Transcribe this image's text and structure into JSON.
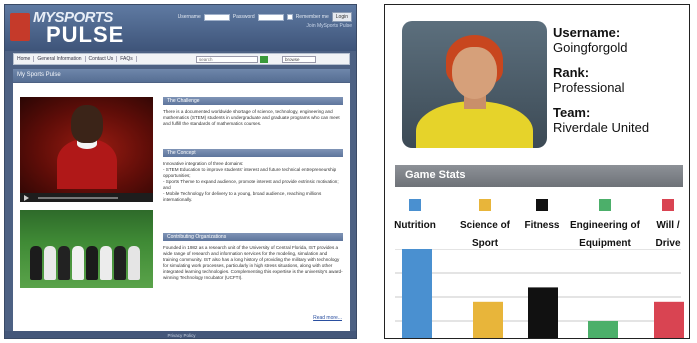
{
  "site": {
    "logo": {
      "line1": "MYSPORTS",
      "line2": "PULSE",
      "tm": "TM"
    },
    "login": {
      "username_label": "Username",
      "password_label": "Password",
      "remember_label": "Remember me",
      "login_button": "Login",
      "join_link": "Join MySports Pulse"
    },
    "nav": {
      "items": [
        "Home",
        "General Information",
        "Contact Us",
        "FAQs"
      ],
      "search_placeholder": "search",
      "browse_label": "browse"
    },
    "page_title": "My Sports Pulse",
    "sections": [
      {
        "title": "The Challenge",
        "text": "There is a documented worldwide shortage of science, technology, engineering and mathematics (STEM) students in undergraduate and graduate programs who can meet and fulfill the standards of mathematics courses."
      },
      {
        "title": "The Concept",
        "text": "Innovative integration of three domains:\n- STEM Education to improve students' interest and future technical entrepreneurship opportunities;\n- Sports Theme to expand audience, promote interest and provide extrinsic motivation; and\n- Mobile Technology for delivery to a young, broad audience, reaching millions internationally."
      },
      {
        "title": "Contributing Organizations",
        "text": "Founded in 1982 as a research unit of the University of Central Florida, IST provides a wide range of research and information services for the modeling, simulation and training community. IST also has a long history of providing the military with technology for simulating work processes, particularly in high stress situations, along with other integrated learning technologies. Complementing this expertise is the university's award-winning Technology Incubator (UCFTI)."
      }
    ],
    "video_time": "00:00",
    "read_more": "Read more...",
    "footer": "Privacy Policy"
  },
  "profile": {
    "username_label": "Username:",
    "username": "Goingforgold",
    "rank_label": "Rank:",
    "rank": "Professional",
    "team_label": "Team:",
    "team": "Riverdale United",
    "game_stats_title": "Game Stats"
  },
  "chart_data": {
    "type": "bar",
    "categories": [
      "Nutrition",
      "Science of Sport",
      "Fitness",
      "Engineering of Equipment",
      "Will / Drive"
    ],
    "values": [
      100,
      45,
      60,
      25,
      45
    ],
    "colors": [
      "#4a90d0",
      "#e8b53a",
      "#111111",
      "#4caf6a",
      "#d94452"
    ],
    "ylim": [
      0,
      100
    ],
    "grid": true,
    "legend_placement": "top",
    "title": "",
    "xlabel": "",
    "ylabel": ""
  }
}
